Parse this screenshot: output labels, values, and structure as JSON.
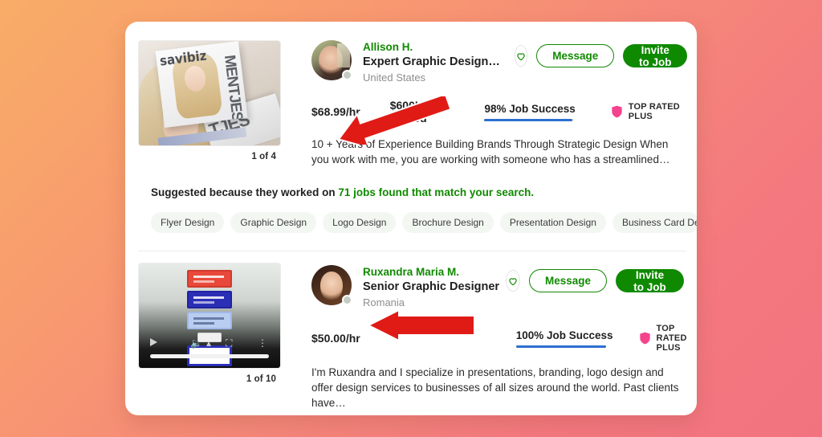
{
  "background": {
    "from": "#f8ad67",
    "to": "#f2737f"
  },
  "accent": {
    "green": "#108a00",
    "blue": "#2e6fd0",
    "pink": "#f5438c",
    "arrow_red": "#e01b16"
  },
  "freelancers": [
    {
      "name": "Allison H.",
      "title": "Expert Graphic Design…",
      "location": "United States",
      "rate": "$68.99/hr",
      "earned": "$600K+ earned",
      "job_success": "98% Job Success",
      "job_success_pct": 98,
      "badge": "TOP RATED PLUS",
      "badge_icon": "shield-icon",
      "description": "10 + Years of Experience Building Brands Through Strategic Design When you work with me, you are working with someone who has a streamlined…",
      "thumb_caption": "1 of 4",
      "thumb_type": "magazine-photo",
      "thumb_text": {
        "masthead": "savibiz",
        "vertical": "MENTJES",
        "lower": "TJES"
      },
      "actions": {
        "heart": "save-icon",
        "message": "Message",
        "invite": "Invite to Job"
      },
      "suggested_prefix": "Suggested because they worked on ",
      "suggested_link": "71 jobs found that match your search.",
      "tags": [
        "Flyer Design",
        "Graphic Design",
        "Logo Design",
        "Brochure Design",
        "Presentation Design",
        "Business Card Design"
      ],
      "tags_next": "›"
    },
    {
      "name": "Ruxandra Maria M.",
      "title": "Senior Graphic Designer",
      "location": "Romania",
      "rate": "$50.00/hr",
      "earned": "",
      "job_success": "100% Job Success",
      "job_success_pct": 100,
      "badge": "TOP RATED PLUS",
      "badge_icon": "shield-icon",
      "description": "I'm Ruxandra and I specialize in presentations, branding, logo design and offer design services to businesses of all sizes around the world. Past clients have…",
      "thumb_caption": "1 of 10",
      "thumb_type": "video-player",
      "actions": {
        "heart": "save-icon",
        "message": "Message",
        "invite": "Invite to Job"
      }
    }
  ]
}
